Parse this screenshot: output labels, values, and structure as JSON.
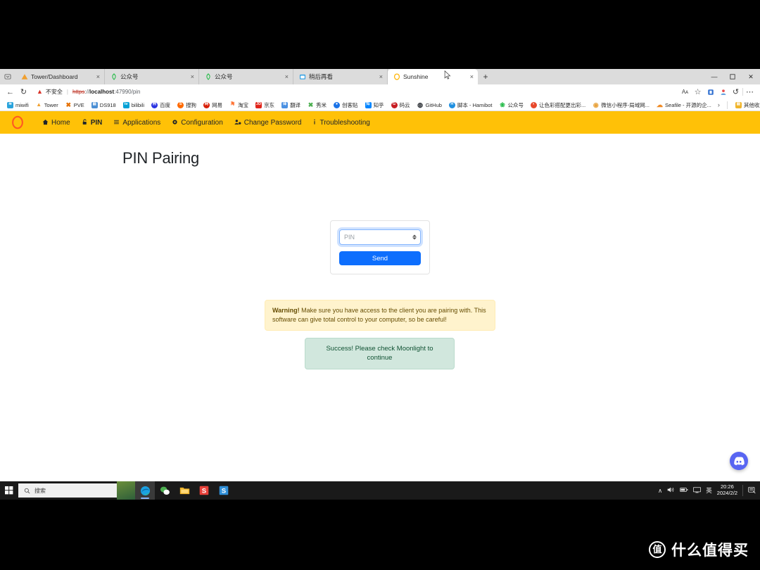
{
  "browser": {
    "tabs": [
      {
        "title": "Tower/Dashboard",
        "favicon": "warning-triangle-icon",
        "favicon_color": "#f0a030",
        "active": false,
        "close_label": "×"
      },
      {
        "title": "公众号",
        "favicon": "leaf-icon",
        "favicon_color": "#21ba45",
        "active": false,
        "close_label": "×"
      },
      {
        "title": "公众号",
        "favicon": "leaf-icon",
        "favicon_color": "#21ba45",
        "active": false,
        "close_label": "×"
      },
      {
        "title": "稍后再看",
        "favicon": "calendar-icon",
        "favicon_color": "#3aa3e3",
        "active": false,
        "close_label": "×"
      },
      {
        "title": "Sunshine",
        "favicon": "sunshine-icon",
        "favicon_color": "#ffb300",
        "active": true,
        "close_label": "×"
      }
    ],
    "new_tab_label": "+",
    "window_controls": {
      "minimize": "—",
      "maximize": "⬜",
      "close": "✕"
    },
    "toolbar": {
      "back_label": "←",
      "refresh_label": "↻",
      "security_text": "不安全",
      "url_scheme": "https",
      "url_separator": "://",
      "url_host": "localhost",
      "url_port": ":47990",
      "url_path": "/pin",
      "read_aloud_label": "Aᴀ",
      "favorite_label": "☆",
      "collections_label": "□",
      "profile_label": "●",
      "history_label": "↺",
      "settings_label": "⋯"
    },
    "bookmarks": [
      {
        "label": "miwifi",
        "icon": "wifi-icon",
        "color": "#29a3dc"
      },
      {
        "label": "Tower",
        "icon": "triangle-icon",
        "color": "#f0a030"
      },
      {
        "label": "PVE",
        "icon": "proxmox-icon",
        "color": "#e57000"
      },
      {
        "label": "DS918",
        "icon": "synology-icon",
        "color": "#4b8fd4"
      },
      {
        "label": "bilibili",
        "icon": "bilibili-icon",
        "color": "#00a1d6"
      },
      {
        "label": "百度",
        "icon": "baidu-icon",
        "color": "#2932e1"
      },
      {
        "label": "搜狗",
        "icon": "sogou-icon",
        "color": "#ff6a00"
      },
      {
        "label": "网易",
        "icon": "netease-icon",
        "color": "#d81e06"
      },
      {
        "label": "淘宝",
        "icon": "taobao-icon",
        "color": "#ff5000"
      },
      {
        "label": "京东",
        "icon": "jd-icon",
        "color": "#e1251b"
      },
      {
        "label": "翻译",
        "icon": "translate-icon",
        "color": "#4a90e2"
      },
      {
        "label": "秀米",
        "icon": "xiumi-icon",
        "color": "#4caf50"
      },
      {
        "label": "创客贴",
        "icon": "chuangketie-icon",
        "color": "#1a73e8"
      },
      {
        "label": "知乎",
        "icon": "zhihu-icon",
        "color": "#0084ff"
      },
      {
        "label": "码云",
        "icon": "gitee-icon",
        "color": "#c71d23"
      },
      {
        "label": "GitHub",
        "icon": "github-icon",
        "color": "#24292e"
      },
      {
        "label": "脚本 - Hamibot",
        "icon": "hamibot-icon",
        "color": "#1f8fe0"
      },
      {
        "label": "公众号",
        "icon": "leaf-icon",
        "color": "#21ba45"
      },
      {
        "label": "让色彩搭配更出彩...",
        "icon": "color-icon",
        "color": "#e8482b"
      },
      {
        "label": "微信小程序-局域网...",
        "icon": "wechat-mini-icon",
        "color": "#e8a33d"
      },
      {
        "label": "Seafile - 开源的企...",
        "icon": "seafile-icon",
        "color": "#f08a24"
      }
    ],
    "bookmarks_overflow_label": "›",
    "other_favorites_label": "其他收藏夹",
    "other_favorites_icon": "folder-icon"
  },
  "app": {
    "brand_icon": "sunshine-logo",
    "nav": [
      {
        "label": "Home",
        "icon": "home-icon",
        "glyph": "⌂",
        "active": false
      },
      {
        "label": "PIN",
        "icon": "lock-icon",
        "glyph": "🔓",
        "active": true
      },
      {
        "label": "Applications",
        "icon": "list-icon",
        "glyph": "≡",
        "active": false
      },
      {
        "label": "Configuration",
        "icon": "gear-icon",
        "glyph": "⚙",
        "active": false
      },
      {
        "label": "Change Password",
        "icon": "user-gear-icon",
        "glyph": "👤",
        "active": false
      },
      {
        "label": "Troubleshooting",
        "icon": "info-icon",
        "glyph": "ℹ",
        "active": false
      }
    ],
    "page_title": "PIN Pairing",
    "form": {
      "pin_placeholder": "PIN",
      "pin_value": "",
      "spinner_up_label": "▲",
      "spinner_down_label": "▼",
      "send_label": "Send"
    },
    "warning": {
      "strong": "Warning!",
      "text": " Make sure you have access to the client you are pairing with. This software can give total control to your computer, so be careful!"
    },
    "success": {
      "text": "Success! Please check Moonlight to continue"
    },
    "discord_label": "discord-icon"
  },
  "taskbar": {
    "start_label": "start-icon",
    "search_placeholder": "搜索",
    "search_icon": "search-icon",
    "apps": [
      {
        "name": "edge-icon",
        "active": true
      },
      {
        "name": "wechat-icon",
        "active": false
      },
      {
        "name": "file-explorer-icon",
        "active": false
      },
      {
        "name": "snipaste-red-icon",
        "active": false
      },
      {
        "name": "snipaste-blue-icon",
        "active": false
      }
    ],
    "tray": {
      "chevron": "∧",
      "volume": "volume-icon",
      "battery": "battery-icon",
      "network": "network-icon",
      "ime": "英",
      "time": "20:26",
      "date": "2024/2/2",
      "notifications": "notification-icon"
    }
  },
  "watermark": {
    "badge": "值",
    "text": "什么值得买"
  },
  "colors": {
    "navbar": "#ffc107",
    "primary": "#0d6efd",
    "warning_bg": "#fff3cd",
    "success_bg": "#d1e7dd",
    "discord": "#5865f2"
  }
}
